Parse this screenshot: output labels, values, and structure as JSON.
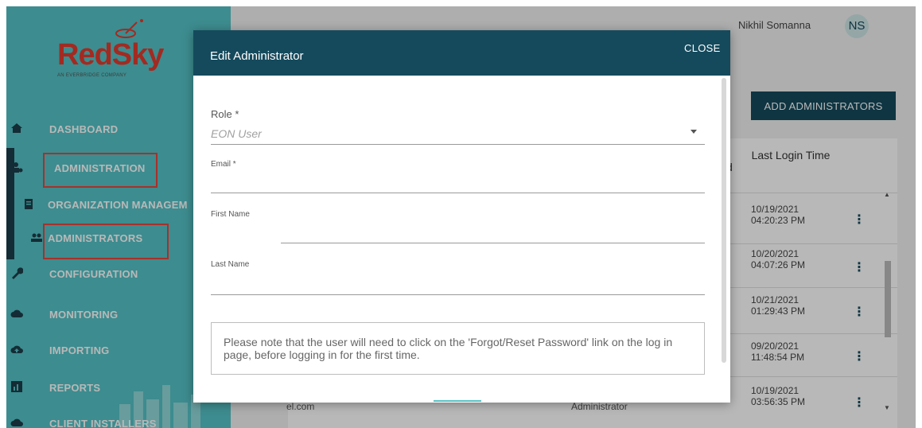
{
  "brand": {
    "name": "RedSky",
    "tagline": "AN EVERBRIDGE COMPANY"
  },
  "sidebar": {
    "items": [
      {
        "label": "DASHBOARD",
        "icon": "home-icon"
      },
      {
        "label": "ADMINISTRATION",
        "icon": "admin-icon"
      },
      {
        "label": "ORGANIZATION MANAGEM",
        "icon": "clipboard-icon"
      },
      {
        "label": "ADMINISTRATORS",
        "icon": "users-icon"
      },
      {
        "label": "CONFIGURATION",
        "icon": "wrench-icon"
      },
      {
        "label": "MONITORING",
        "icon": "cloud-icon"
      },
      {
        "label": "IMPORTING",
        "icon": "cloud-upload-icon"
      },
      {
        "label": "REPORTS",
        "icon": "chart-icon"
      },
      {
        "label": "CLIENT INSTALLERS",
        "icon": "cloud-download-icon"
      }
    ]
  },
  "header": {
    "user_name": "Nikhil Somanna",
    "user_initials": "NS"
  },
  "main": {
    "add_button": "ADD ADMINISTRATORS",
    "column_header": "Last Login Time",
    "column_partial": "d",
    "rows": [
      {
        "date": "10/19/2021",
        "time": "04:20:23 PM"
      },
      {
        "date": "10/20/2021",
        "time": "04:07:26 PM"
      },
      {
        "date": "10/21/2021",
        "time": "01:29:43 PM"
      },
      {
        "date": "09/20/2021",
        "time": "11:48:54 PM"
      },
      {
        "date": "10/19/2021",
        "time": "03:56:35 PM"
      }
    ],
    "bg_email_fragment": "el.com",
    "bg_role_fragment": "Administrator"
  },
  "modal": {
    "title": "Edit Administrator",
    "close_label": "CLOSE",
    "role_label": "Role *",
    "role_value": "EON User",
    "email_label": "Email *",
    "first_name_label": "First Name",
    "last_name_label": "Last Name",
    "note": "Please note that the user will need to click on the 'Forgot/Reset Password' link on the log in page, before logging in for the first time."
  },
  "colors": {
    "sidebar": "#55c3c6",
    "primary": "#154a5c",
    "brand_red": "#e23b2e",
    "highlight": "#e8453c"
  }
}
